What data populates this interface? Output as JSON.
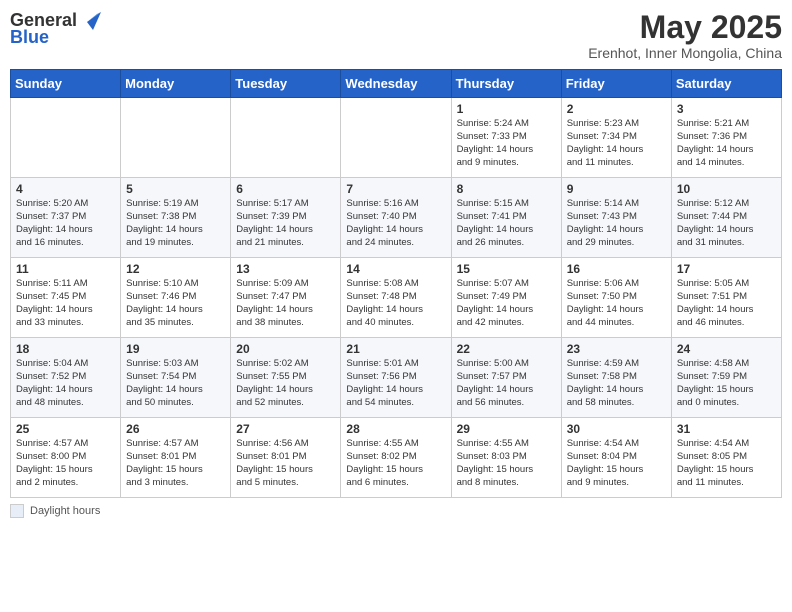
{
  "header": {
    "logo_general": "General",
    "logo_blue": "Blue",
    "month_year": "May 2025",
    "location": "Erenhot, Inner Mongolia, China"
  },
  "weekdays": [
    "Sunday",
    "Monday",
    "Tuesday",
    "Wednesday",
    "Thursday",
    "Friday",
    "Saturday"
  ],
  "footer": {
    "label": "Daylight hours"
  },
  "weeks": [
    [
      {
        "day": "",
        "info": ""
      },
      {
        "day": "",
        "info": ""
      },
      {
        "day": "",
        "info": ""
      },
      {
        "day": "",
        "info": ""
      },
      {
        "day": "1",
        "info": "Sunrise: 5:24 AM\nSunset: 7:33 PM\nDaylight: 14 hours\nand 9 minutes."
      },
      {
        "day": "2",
        "info": "Sunrise: 5:23 AM\nSunset: 7:34 PM\nDaylight: 14 hours\nand 11 minutes."
      },
      {
        "day": "3",
        "info": "Sunrise: 5:21 AM\nSunset: 7:36 PM\nDaylight: 14 hours\nand 14 minutes."
      }
    ],
    [
      {
        "day": "4",
        "info": "Sunrise: 5:20 AM\nSunset: 7:37 PM\nDaylight: 14 hours\nand 16 minutes."
      },
      {
        "day": "5",
        "info": "Sunrise: 5:19 AM\nSunset: 7:38 PM\nDaylight: 14 hours\nand 19 minutes."
      },
      {
        "day": "6",
        "info": "Sunrise: 5:17 AM\nSunset: 7:39 PM\nDaylight: 14 hours\nand 21 minutes."
      },
      {
        "day": "7",
        "info": "Sunrise: 5:16 AM\nSunset: 7:40 PM\nDaylight: 14 hours\nand 24 minutes."
      },
      {
        "day": "8",
        "info": "Sunrise: 5:15 AM\nSunset: 7:41 PM\nDaylight: 14 hours\nand 26 minutes."
      },
      {
        "day": "9",
        "info": "Sunrise: 5:14 AM\nSunset: 7:43 PM\nDaylight: 14 hours\nand 29 minutes."
      },
      {
        "day": "10",
        "info": "Sunrise: 5:12 AM\nSunset: 7:44 PM\nDaylight: 14 hours\nand 31 minutes."
      }
    ],
    [
      {
        "day": "11",
        "info": "Sunrise: 5:11 AM\nSunset: 7:45 PM\nDaylight: 14 hours\nand 33 minutes."
      },
      {
        "day": "12",
        "info": "Sunrise: 5:10 AM\nSunset: 7:46 PM\nDaylight: 14 hours\nand 35 minutes."
      },
      {
        "day": "13",
        "info": "Sunrise: 5:09 AM\nSunset: 7:47 PM\nDaylight: 14 hours\nand 38 minutes."
      },
      {
        "day": "14",
        "info": "Sunrise: 5:08 AM\nSunset: 7:48 PM\nDaylight: 14 hours\nand 40 minutes."
      },
      {
        "day": "15",
        "info": "Sunrise: 5:07 AM\nSunset: 7:49 PM\nDaylight: 14 hours\nand 42 minutes."
      },
      {
        "day": "16",
        "info": "Sunrise: 5:06 AM\nSunset: 7:50 PM\nDaylight: 14 hours\nand 44 minutes."
      },
      {
        "day": "17",
        "info": "Sunrise: 5:05 AM\nSunset: 7:51 PM\nDaylight: 14 hours\nand 46 minutes."
      }
    ],
    [
      {
        "day": "18",
        "info": "Sunrise: 5:04 AM\nSunset: 7:52 PM\nDaylight: 14 hours\nand 48 minutes."
      },
      {
        "day": "19",
        "info": "Sunrise: 5:03 AM\nSunset: 7:54 PM\nDaylight: 14 hours\nand 50 minutes."
      },
      {
        "day": "20",
        "info": "Sunrise: 5:02 AM\nSunset: 7:55 PM\nDaylight: 14 hours\nand 52 minutes."
      },
      {
        "day": "21",
        "info": "Sunrise: 5:01 AM\nSunset: 7:56 PM\nDaylight: 14 hours\nand 54 minutes."
      },
      {
        "day": "22",
        "info": "Sunrise: 5:00 AM\nSunset: 7:57 PM\nDaylight: 14 hours\nand 56 minutes."
      },
      {
        "day": "23",
        "info": "Sunrise: 4:59 AM\nSunset: 7:58 PM\nDaylight: 14 hours\nand 58 minutes."
      },
      {
        "day": "24",
        "info": "Sunrise: 4:58 AM\nSunset: 7:59 PM\nDaylight: 15 hours\nand 0 minutes."
      }
    ],
    [
      {
        "day": "25",
        "info": "Sunrise: 4:57 AM\nSunset: 8:00 PM\nDaylight: 15 hours\nand 2 minutes."
      },
      {
        "day": "26",
        "info": "Sunrise: 4:57 AM\nSunset: 8:01 PM\nDaylight: 15 hours\nand 3 minutes."
      },
      {
        "day": "27",
        "info": "Sunrise: 4:56 AM\nSunset: 8:01 PM\nDaylight: 15 hours\nand 5 minutes."
      },
      {
        "day": "28",
        "info": "Sunrise: 4:55 AM\nSunset: 8:02 PM\nDaylight: 15 hours\nand 6 minutes."
      },
      {
        "day": "29",
        "info": "Sunrise: 4:55 AM\nSunset: 8:03 PM\nDaylight: 15 hours\nand 8 minutes."
      },
      {
        "day": "30",
        "info": "Sunrise: 4:54 AM\nSunset: 8:04 PM\nDaylight: 15 hours\nand 9 minutes."
      },
      {
        "day": "31",
        "info": "Sunrise: 4:54 AM\nSunset: 8:05 PM\nDaylight: 15 hours\nand 11 minutes."
      }
    ]
  ]
}
